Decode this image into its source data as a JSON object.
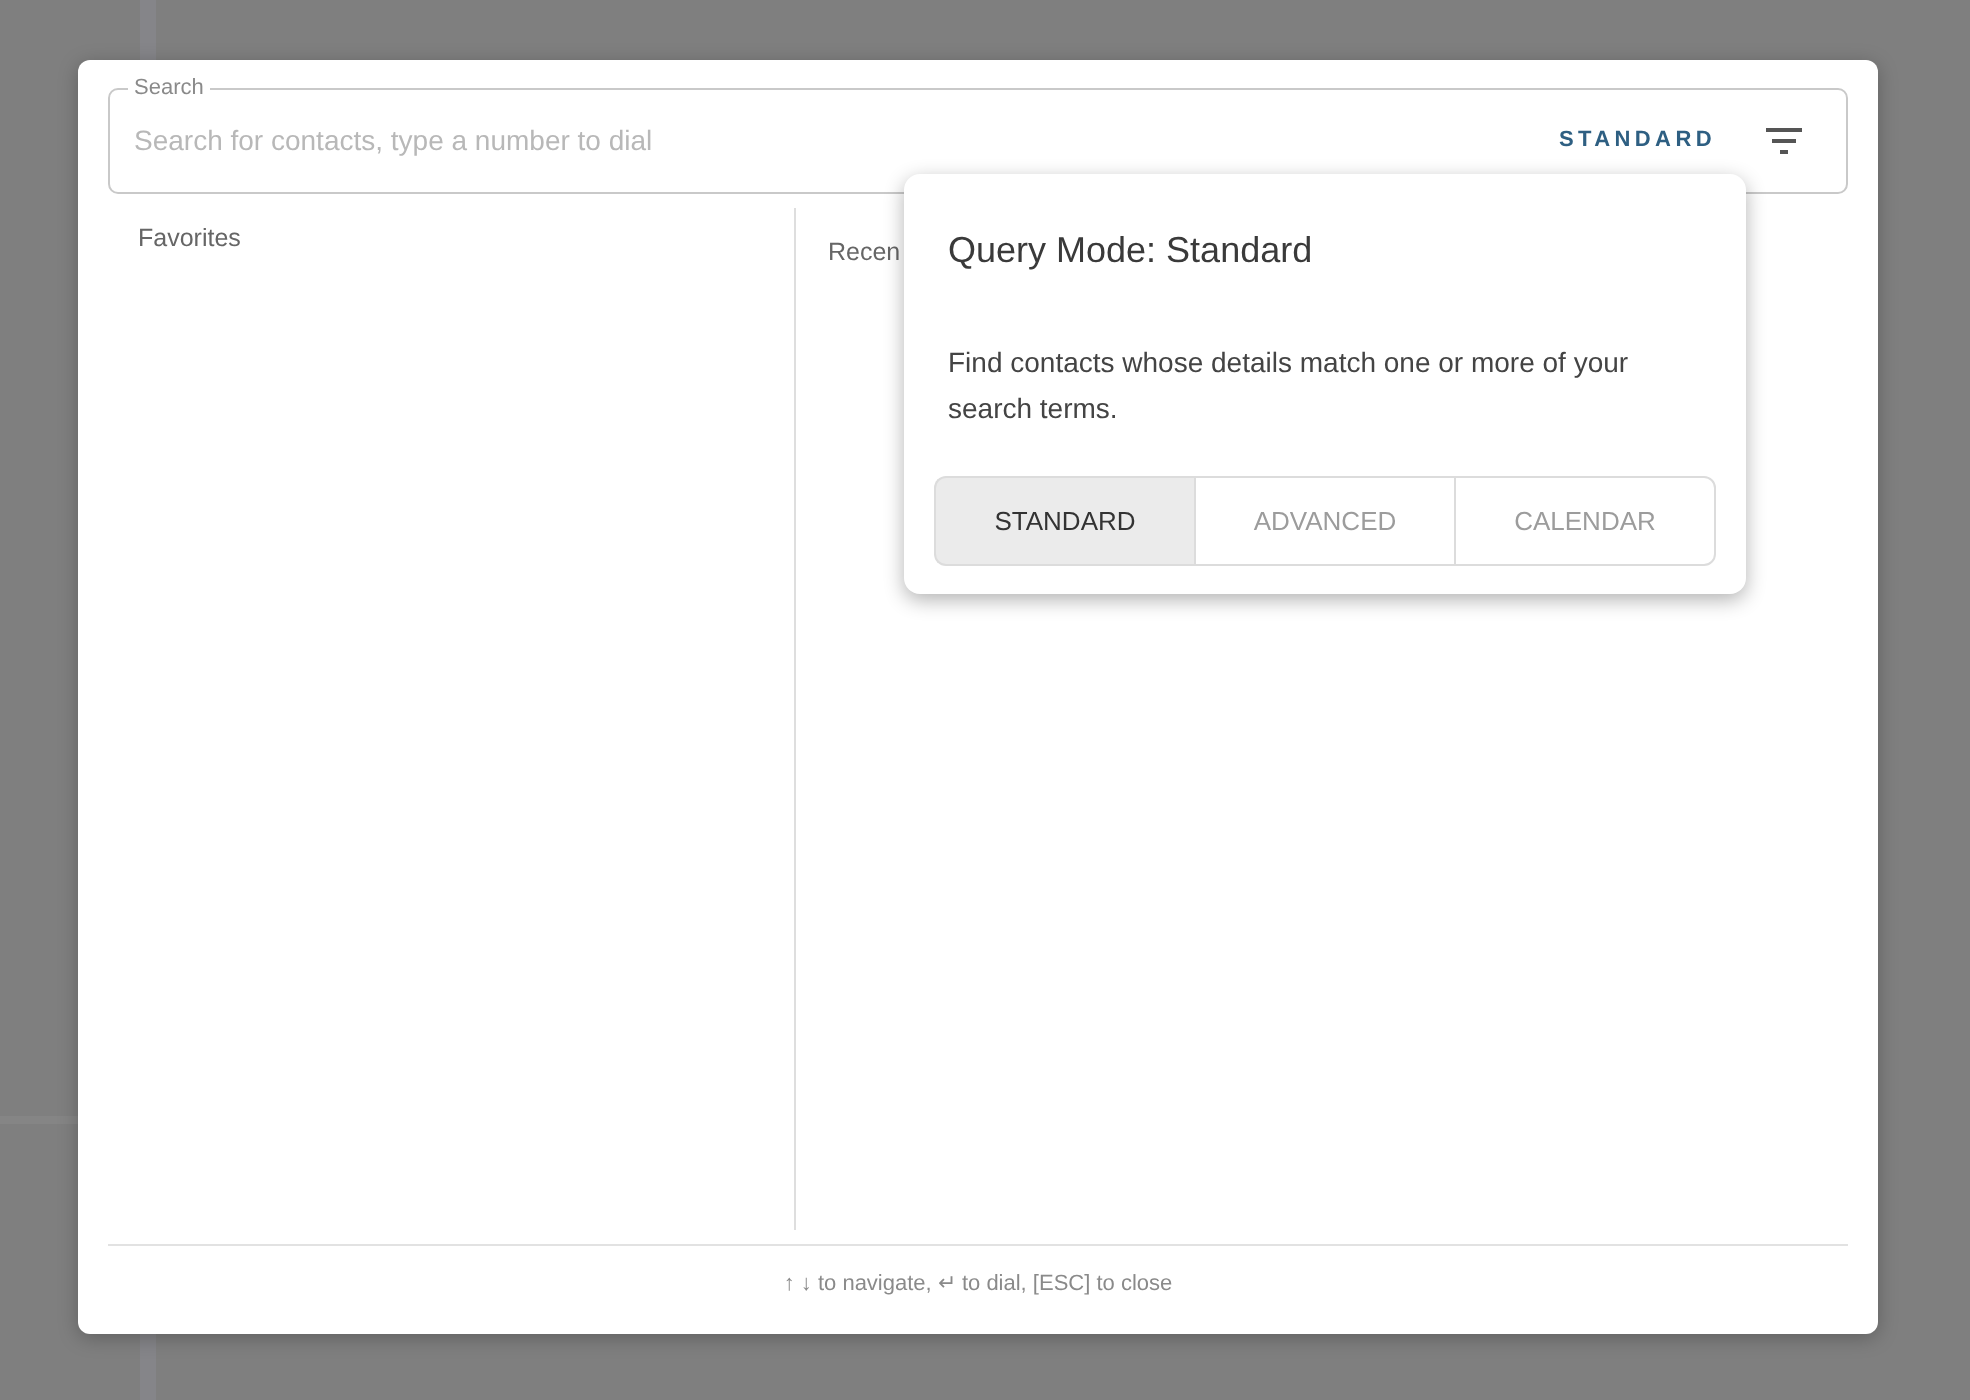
{
  "search": {
    "label": "Search",
    "placeholder": "Search for contacts, type a number to dial",
    "mode_button": "STANDARD"
  },
  "panels": [
    {
      "title": "Favorites"
    },
    {
      "title": "Recen"
    }
  ],
  "footer": "↑ ↓ to navigate, ↵ to dial, [ESC] to close",
  "popover": {
    "title": "Query Mode: Standard",
    "description": "Find contacts whose details match one or more of your search terms.",
    "modes": [
      {
        "label": "STANDARD",
        "selected": true
      },
      {
        "label": "ADVANCED",
        "selected": false
      },
      {
        "label": "CALENDAR",
        "selected": false
      }
    ]
  }
}
